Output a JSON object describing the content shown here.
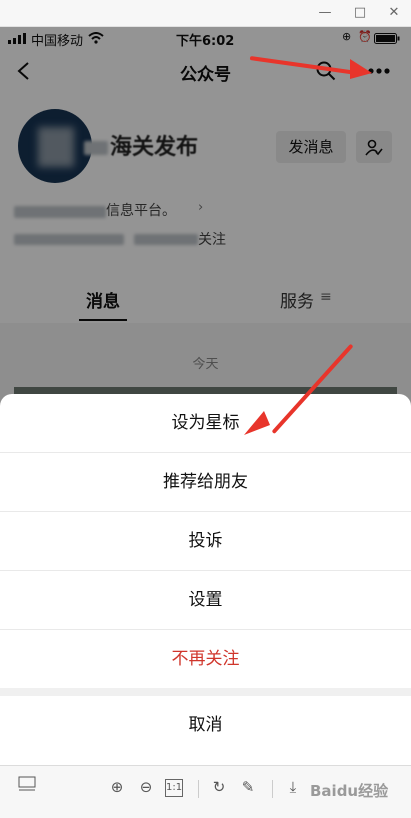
{
  "window": {
    "buttons": [
      "—",
      "□",
      "✕"
    ]
  },
  "statusbar": {
    "carrier": "中国移动",
    "time": "下午6:02"
  },
  "navbar": {
    "title": "公众号",
    "back_icon": "chevron-left-icon",
    "search_icon": "search-icon",
    "more_icon": "more-icon"
  },
  "profile": {
    "name": "海关发布",
    "send_message_label": "发消息",
    "description_visible": "信息平台。",
    "follow_visible": "关注"
  },
  "tabs": {
    "messages": "消息",
    "services": "服务"
  },
  "feed": {
    "date_label": "今天"
  },
  "action_sheet": {
    "items": [
      "设为星标",
      "推荐给朋友",
      "投诉",
      "设置",
      "不再关注"
    ],
    "cancel_label": "取消",
    "danger_color": "#d0352b"
  },
  "viewer_toolbar": {
    "zoom_label": "1:1",
    "watermark": "Baidu经验"
  },
  "colors": {
    "accent_arrow": "#e8352b",
    "overlay": "rgba(0,0,0,0.42)"
  }
}
